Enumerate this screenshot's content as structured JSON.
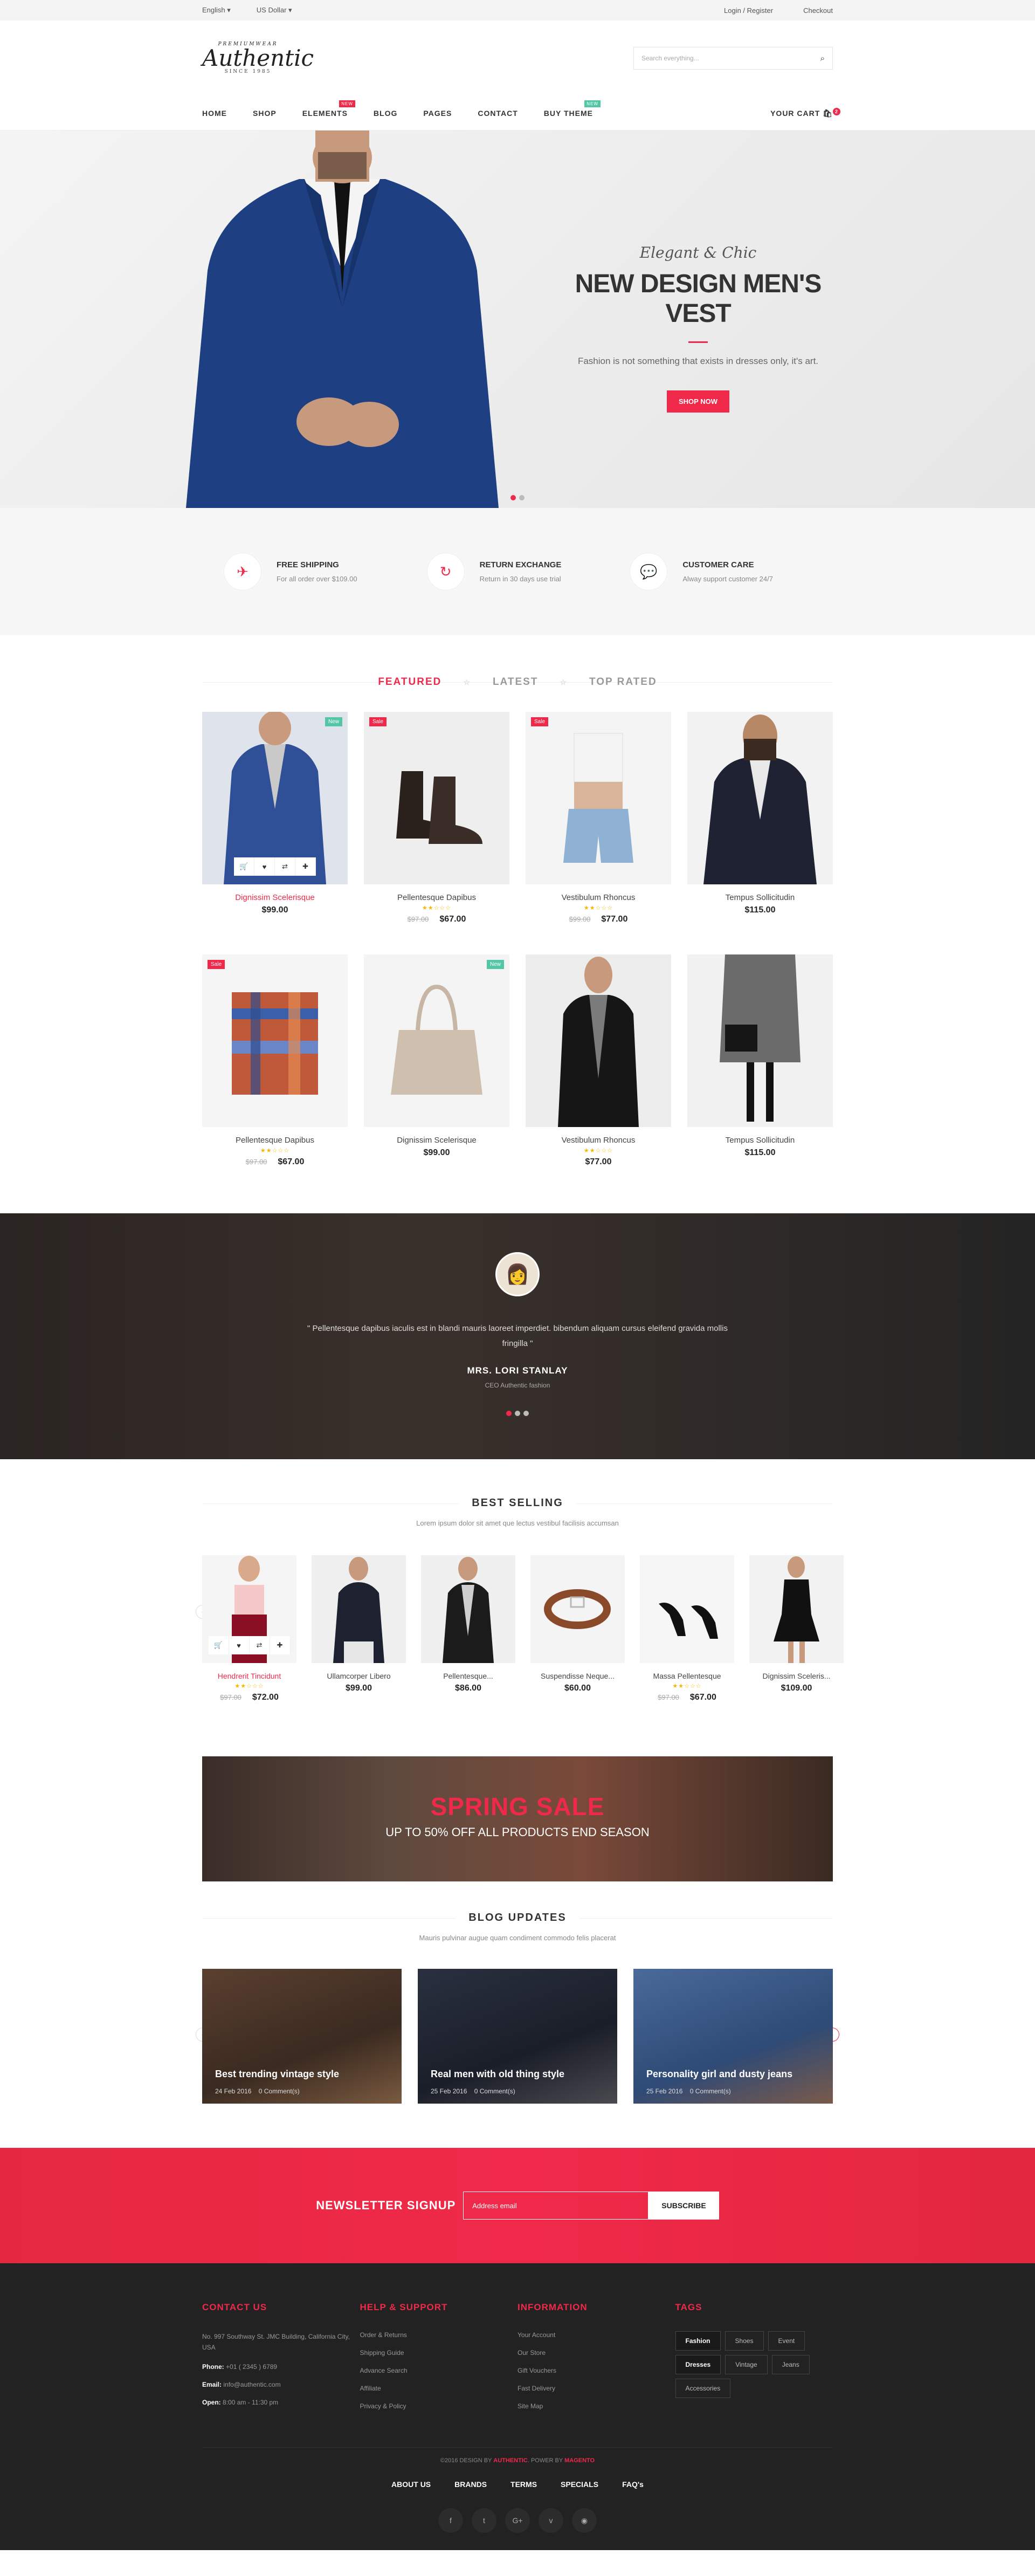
{
  "topbar": {
    "language": "English",
    "currency": "US Dollar",
    "login": "Login / Register",
    "checkout": "Checkout"
  },
  "logo": {
    "top": "PREMIUMWEAR",
    "name": "Authentic",
    "since": "SINCE 1985"
  },
  "search": {
    "placeholder": "Search everything..."
  },
  "nav": {
    "items": [
      "HOME",
      "SHOP",
      "ELEMENTS",
      "BLOG",
      "PAGES",
      "CONTACT",
      "BUY THEME"
    ],
    "elements_badge": "NEW",
    "buytheme_badge": "NEW",
    "cart": "YOUR CART",
    "cart_count": "2"
  },
  "hero": {
    "script": "Elegant & Chic",
    "title": "NEW DESIGN MEN'S VEST",
    "text": "Fashion is not something that exists in dresses only, it's art.",
    "button": "SHOP NOW"
  },
  "features": [
    {
      "title": "FREE SHIPPING",
      "text": "For all order over $109.00",
      "icon": "plane-icon"
    },
    {
      "title": "RETURN EXCHANGE",
      "text": "Return in 30 days use trial",
      "icon": "refresh-icon"
    },
    {
      "title": "CUSTOMER CARE",
      "text": "Alway support customer 24/7",
      "icon": "chat-icon"
    }
  ],
  "tabs": [
    "FEATURED",
    "LATEST",
    "TOP RATED"
  ],
  "products": [
    {
      "name": "Dignissim Scelerisque",
      "price": "$99.00",
      "old": "",
      "label": "New"
    },
    {
      "name": "Pellentesque Dapibus",
      "price": "$67.00",
      "old": "$97.00",
      "label": "Sale"
    },
    {
      "name": "Vestibulum Rhoncus",
      "price": "$77.00",
      "old": "$99.00",
      "label": "Sale"
    },
    {
      "name": "Tempus Sollicitudin",
      "price": "$115.00",
      "old": "",
      "label": ""
    },
    {
      "name": "Pellentesque Dapibus",
      "price": "$67.00",
      "old": "$97.00",
      "label": "Sale"
    },
    {
      "name": "Dignissim Scelerisque",
      "price": "$99.00",
      "old": "",
      "label": "New"
    },
    {
      "name": "Vestibulum Rhoncus",
      "price": "$77.00",
      "old": "",
      "label": ""
    },
    {
      "name": "Tempus Sollicitudin",
      "price": "$115.00",
      "old": "",
      "label": ""
    }
  ],
  "testimonial": {
    "quote": "\" Pellentesque dapibus iaculis est in blandi mauris laoreet imperdiet. bibendum aliquam cursus eleifend gravida mollis fringilla \"",
    "name": "MRS. LORI STANLAY",
    "role": "CEO Authentic fashion"
  },
  "best": {
    "title": "BEST SELLING",
    "subtitle": "Lorem ipsum dolor sit amet que lectus vestibul facilisis accumsan",
    "items": [
      {
        "name": "Hendrerit Tincidunt",
        "price": "$72.00",
        "old": "$97.00"
      },
      {
        "name": "Ullamcorper Libero",
        "price": "$99.00",
        "old": ""
      },
      {
        "name": "Pellentesque...",
        "price": "$86.00",
        "old": ""
      },
      {
        "name": "Suspendisse Neque...",
        "price": "$60.00",
        "old": ""
      },
      {
        "name": "Massa Pellentesque",
        "price": "$67.00",
        "old": "$97.00"
      },
      {
        "name": "Dignissim Sceleris...",
        "price": "$109.00",
        "old": ""
      }
    ]
  },
  "banner": {
    "title": "SPRING SALE",
    "subtitle": "UP TO 50% OFF ALL PRODUCTS END SEASON"
  },
  "blog": {
    "title": "BLOG UPDATES",
    "subtitle": "Mauris pulvinar augue quam condiment commodo felis placerat",
    "posts": [
      {
        "title": "Best trending vintage style",
        "date": "24 Feb 2016",
        "comments": "0 Comment(s)"
      },
      {
        "title": "Real men with old thing style",
        "date": "25 Feb 2016",
        "comments": "0 Comment(s)"
      },
      {
        "title": "Personality girl and dusty jeans",
        "date": "25 Feb 2016",
        "comments": "0 Comment(s)"
      }
    ]
  },
  "newsletter": {
    "title": "NEWSLETTER SIGNUP",
    "placeholder": "Address email",
    "button": "SUBSCRIBE"
  },
  "footer": {
    "contact": {
      "title": "CONTACT US",
      "address": "No. 997 Southway St. JMC Building, California City, USA",
      "phone_label": "Phone:",
      "phone": "+01 ( 2345 ) 6789",
      "email_label": "Email:",
      "email": "info@authentic.com",
      "open_label": "Open:",
      "open": "8:00 am - 11:30 pm"
    },
    "help": {
      "title": "HELP & SUPPORT",
      "items": [
        "Order & Returns",
        "Shipping Guide",
        "Advance Search",
        "Affiliate",
        "Privacy & Policy"
      ]
    },
    "info": {
      "title": "INFORMATION",
      "items": [
        "Your Account",
        "Our Store",
        "Gift Vouchers",
        "Fast Delivery",
        "Site Map"
      ]
    },
    "tags": {
      "title": "TAGS",
      "items": [
        "Fashion",
        "Shoes",
        "Event",
        "Dresses",
        "Vintage",
        "Jeans",
        "Accessories"
      ]
    },
    "copy_pre": "©2016 DESIGN BY ",
    "copy_by": "AUTHENTIC",
    "copy_mid": ". POWER BY ",
    "copy_power": "MAGENTO",
    "links": [
      "ABOUT US",
      "BRANDS",
      "TERMS",
      "SPECIALS",
      "FAQ's"
    ]
  }
}
